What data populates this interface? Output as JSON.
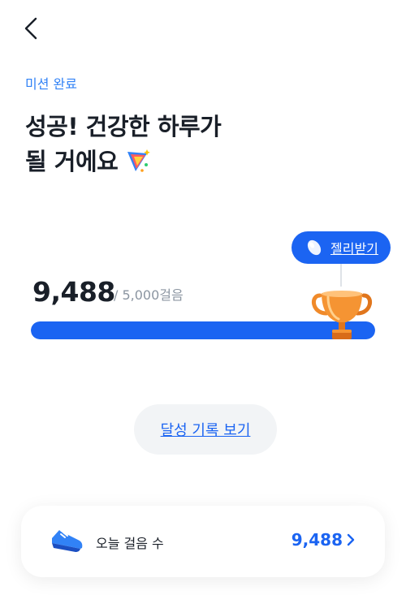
{
  "header": {
    "back_icon": "chevron-left-icon"
  },
  "mission": {
    "label": "미션 완료",
    "title_line1": "성공! 건강한 하루가",
    "title_line2": "될 거에요",
    "title_icon": "party-popper-icon"
  },
  "reward": {
    "button_label": "젤리받기",
    "icon": "jelly-bean-icon"
  },
  "steps": {
    "count": "9,488",
    "goal": "/ 5,000걸음",
    "progress": 1.0,
    "trophy_icon": "trophy-icon"
  },
  "history": {
    "button_label": "달성 기록 보기"
  },
  "today": {
    "icon": "sneaker-icon",
    "label": "오늘 걸음 수",
    "value": "9,488",
    "chevron_icon": "chevron-right-icon"
  },
  "colors": {
    "accent": "#1b64f2",
    "label_blue": "#3182f6",
    "trophy": "#f08a2a"
  }
}
